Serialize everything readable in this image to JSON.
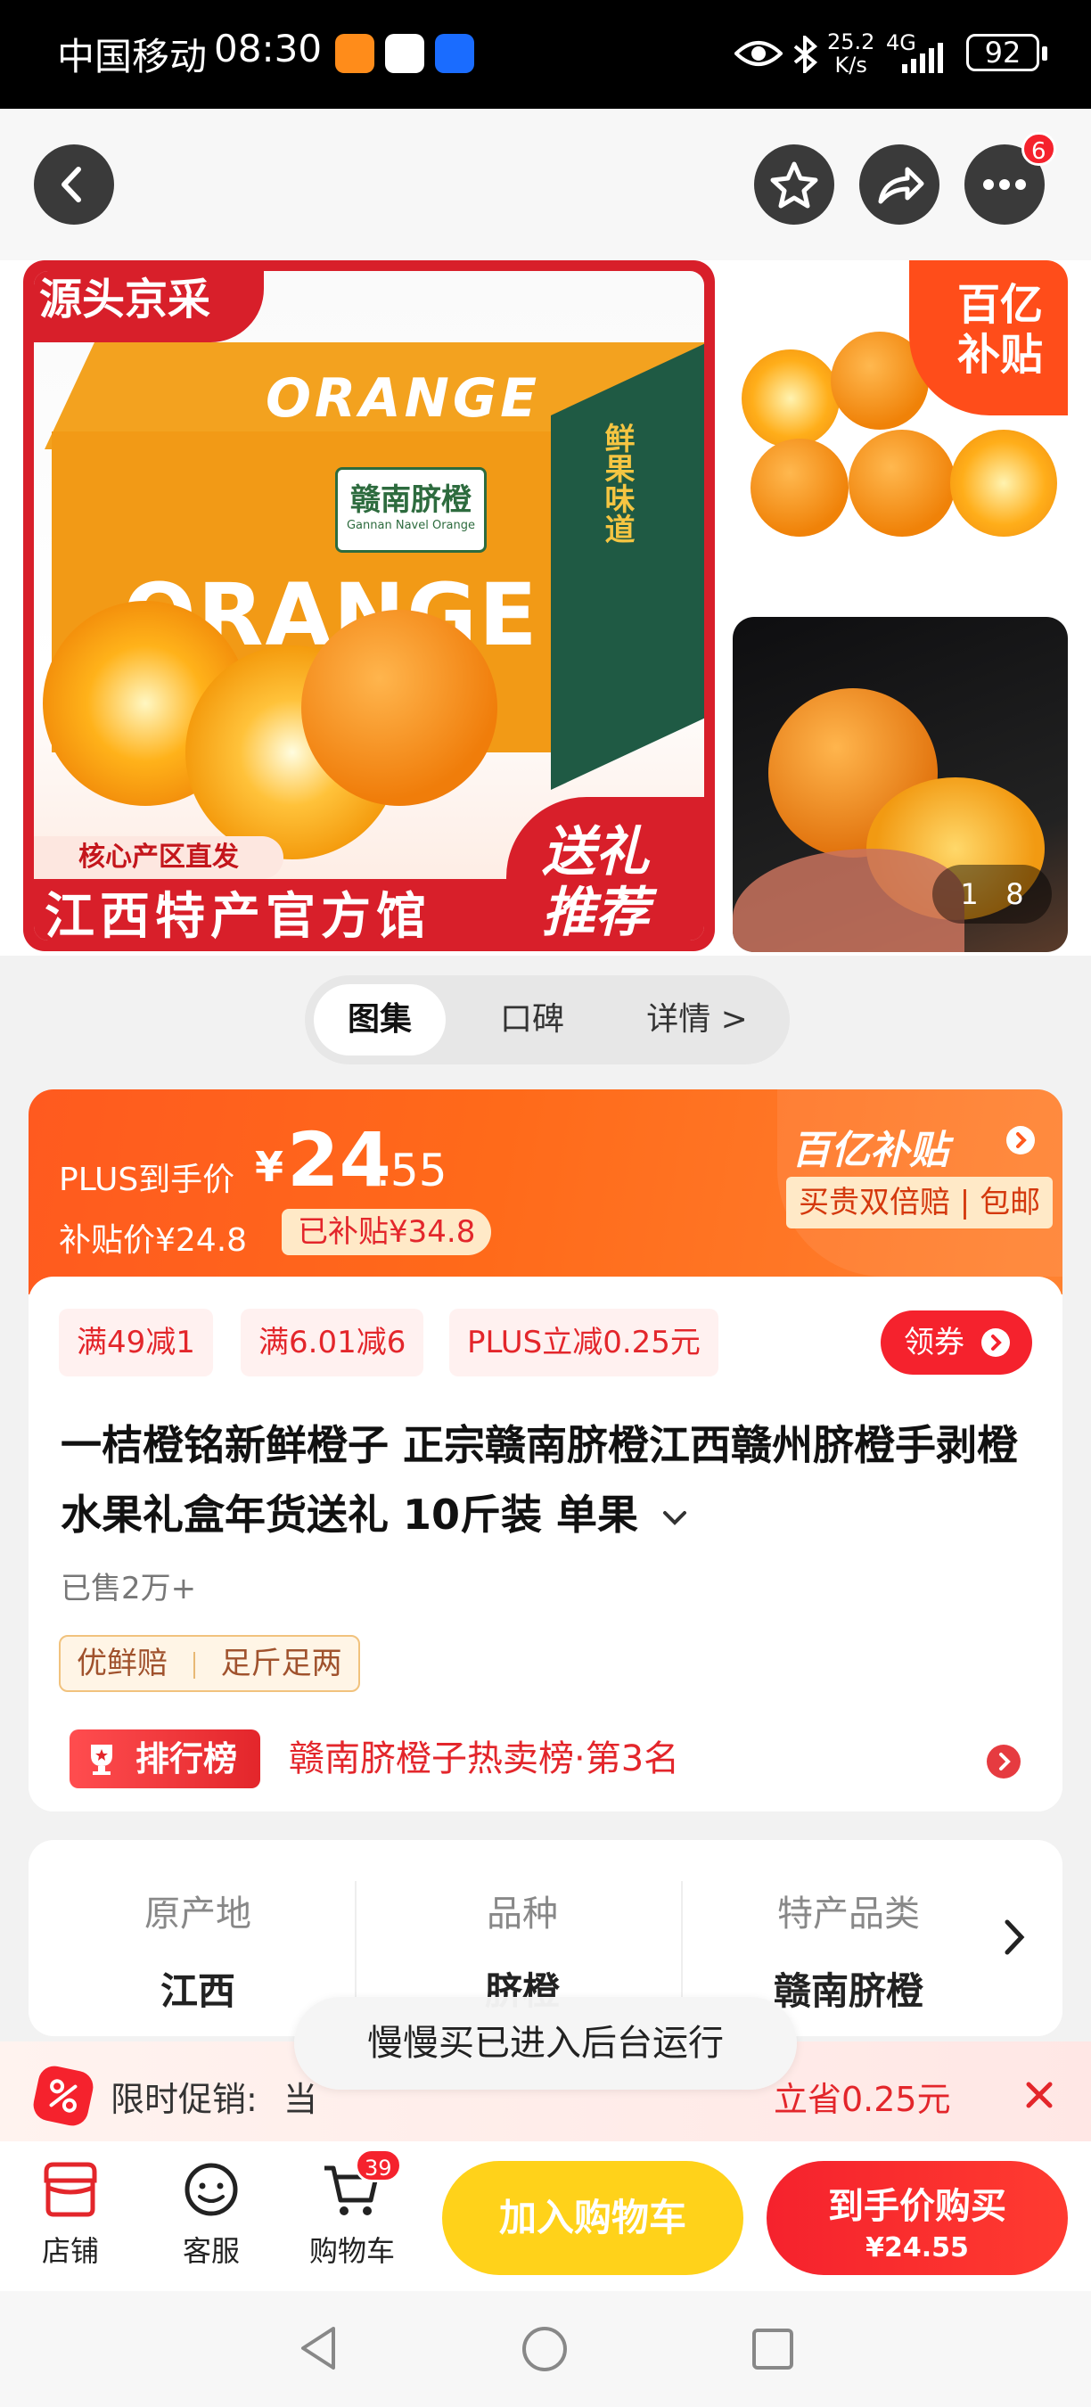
{
  "status_bar": {
    "carrier": "中国移动",
    "time": "08:30",
    "net_speed": "25.2",
    "net_unit": "K/s",
    "network": "4G",
    "battery": "92"
  },
  "top_nav": {
    "more_badge": "6"
  },
  "gallery": {
    "main_image": {
      "top_left_tag": "源头京采",
      "box_text": "ORANGE",
      "box_label": "赣南脐橙",
      "box_label_en": "Gannan Navel Orange",
      "box_side_text": "鲜果味道",
      "origin_tag": "核心产区直发",
      "bottom_banner": "江西特产官方馆",
      "gift_line1": "送礼",
      "gift_line2": "推荐"
    },
    "thumb_badge_line1": "百亿",
    "thumb_badge_line2": "补贴",
    "counter_current": "1",
    "counter_total": "8"
  },
  "tabs": [
    {
      "label": "图集"
    },
    {
      "label": "口碑"
    },
    {
      "label": "详情 >"
    }
  ],
  "price": {
    "plus_label": "PLUS到手价",
    "currency": "¥",
    "integer": "24",
    "decimal": ".55",
    "subsidy_price_label": "补贴价¥24.8",
    "subsidized_tag": "已补贴¥34.8",
    "brand_badge": "百亿补贴",
    "guarantee": "买贵双倍赔 | 包邮"
  },
  "coupons": [
    {
      "label": "满49减1"
    },
    {
      "label": "满6.01减6"
    },
    {
      "label": "PLUS立减0.25元"
    }
  ],
  "claim_button": "领券",
  "product": {
    "title": "一桔橙铭新鲜橙子 正宗赣南脐橙江西赣州脐橙手剥橙 水果礼盒年货送礼 10斤装 单果",
    "sold": "已售2万+",
    "service_tags": [
      "优鲜赔",
      "足斤足两"
    ],
    "rank_badge": "排行榜",
    "rank_text": "赣南脐橙子热卖榜·第3名"
  },
  "specs": [
    {
      "label": "原产地",
      "value": "江西"
    },
    {
      "label": "品种",
      "value": "脐橙"
    },
    {
      "label": "特产品类",
      "value": "赣南脐橙"
    }
  ],
  "promo": {
    "label": "限时促销:",
    "text_visible": "当",
    "save": "立省0.25元"
  },
  "toast": "慢慢买已进入后台运行",
  "bottom_bar": {
    "store": "店铺",
    "service": "客服",
    "cart": "购物车",
    "cart_badge": "39",
    "add_to_cart": "加入购物车",
    "buy_label": "到手价购买",
    "buy_price": "¥24.55"
  },
  "colors": {
    "brand_red": "#e3262b",
    "orange": "#ff6a1a",
    "yellow_button": "#ffd21a"
  }
}
